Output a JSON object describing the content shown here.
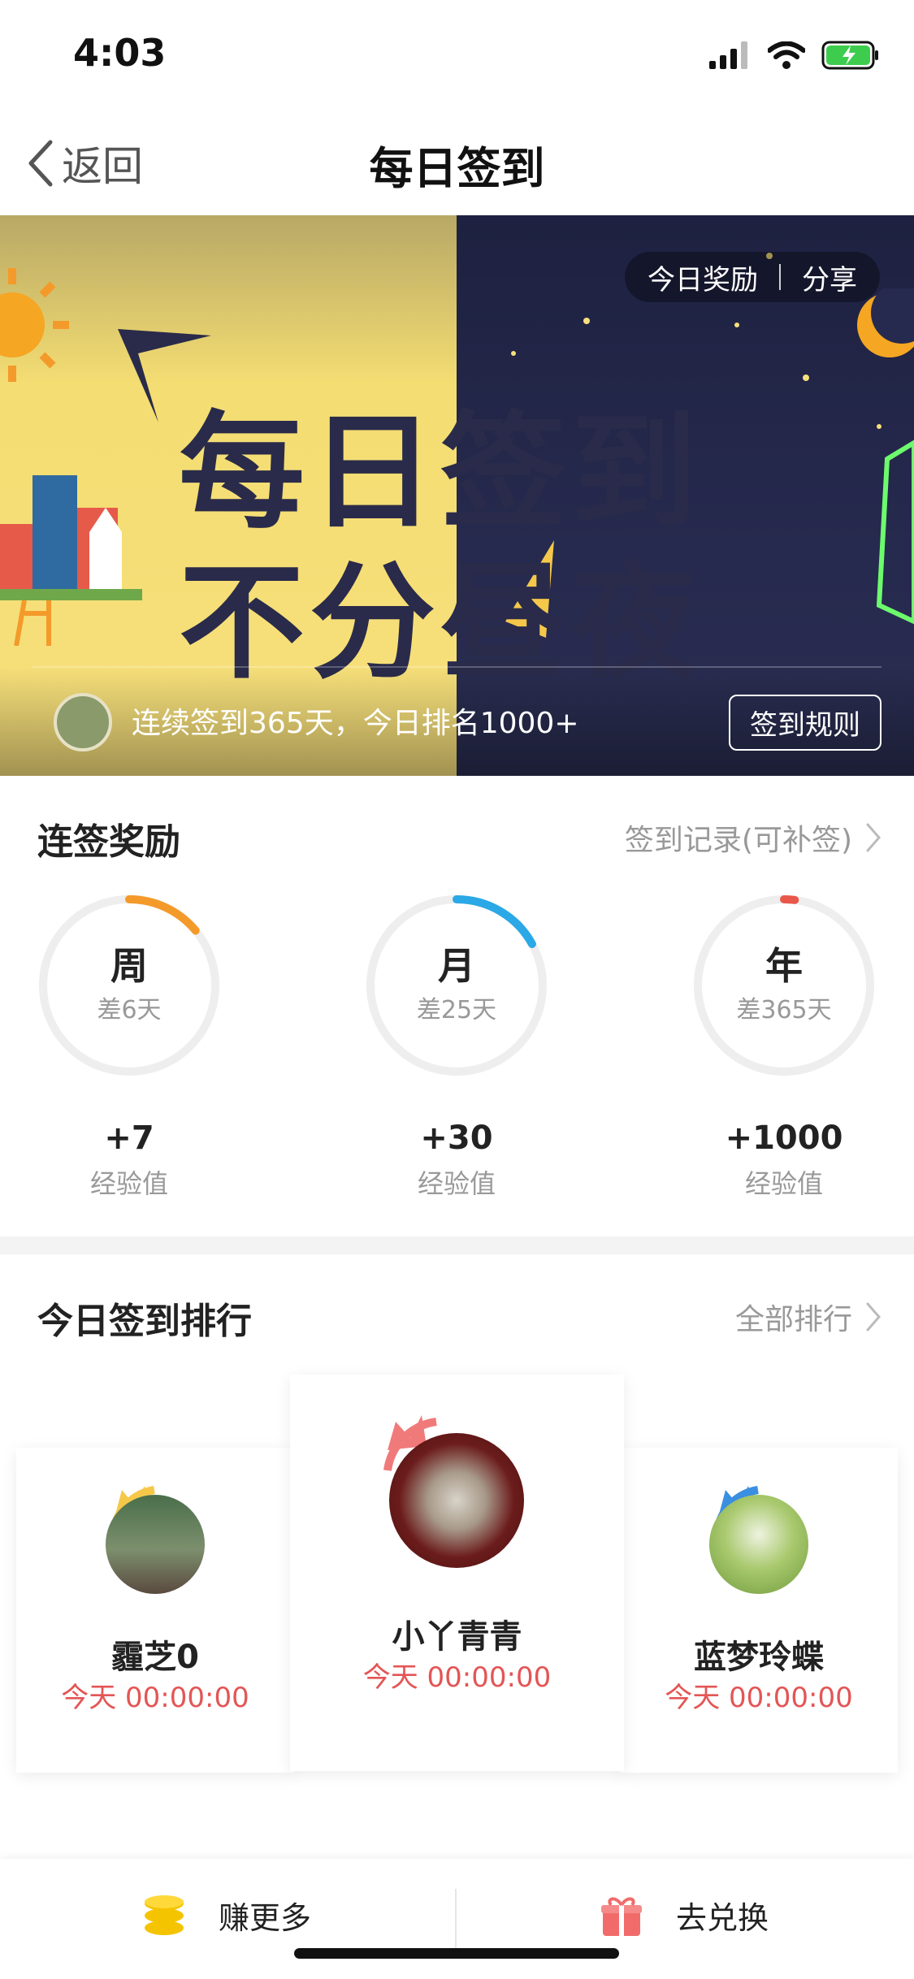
{
  "status_bar": {
    "time": "4:03"
  },
  "nav": {
    "back_label": "返回",
    "title": "每日签到"
  },
  "banner": {
    "chip_left": "今日奖励",
    "chip_right": "分享",
    "headline_line1": "每日签到",
    "headline_line2": "不分昼夜",
    "streak_text": "连续签到365天，今日排名1000+",
    "rules_button": "签到规则"
  },
  "rewards": {
    "title": "连签奖励",
    "record_link": "签到记录(可补签)",
    "items": [
      {
        "label": "周",
        "remaining": "差6天",
        "bonus": "+7",
        "unit": "经验值",
        "progress": 0.14,
        "color": "#f39a2b"
      },
      {
        "label": "月",
        "remaining": "差25天",
        "bonus": "+30",
        "unit": "经验值",
        "progress": 0.17,
        "color": "#2ba8e6"
      },
      {
        "label": "年",
        "remaining": "差365天",
        "bonus": "+1000",
        "unit": "经验值",
        "progress": 0.005,
        "color": "#e9574a"
      }
    ]
  },
  "ranking": {
    "title": "今日签到排行",
    "all_link": "全部排行",
    "entries": [
      {
        "name": "霾芝0",
        "time": "今天 00:00:00",
        "rank": 2
      },
      {
        "name": "小丫青青",
        "time": "今天 00:00:00",
        "rank": 1
      },
      {
        "name": "蓝梦玲蝶",
        "time": "今天 00:00:00",
        "rank": 3
      }
    ]
  },
  "bottom_bar": {
    "earn_label": "赚更多",
    "redeem_label": "去兑换"
  },
  "colors": {
    "accent": "#f7e07c",
    "night": "#262a4e",
    "time_red": "#e45555"
  }
}
